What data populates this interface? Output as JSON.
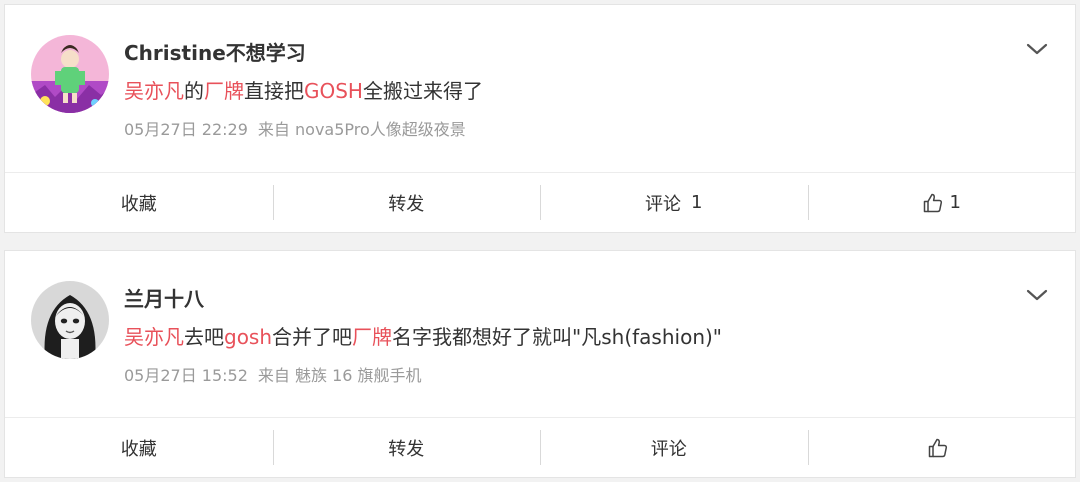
{
  "comments": [
    {
      "username": "Christine不想学习",
      "content": [
        {
          "text": "吴亦凡",
          "highlight": true
        },
        {
          "text": "的",
          "highlight": false
        },
        {
          "text": "厂牌",
          "highlight": true
        },
        {
          "text": "直接把",
          "highlight": false
        },
        {
          "text": "GOSH",
          "highlight": true
        },
        {
          "text": "全搬过来得了",
          "highlight": false
        }
      ],
      "time": "05月27日 22:29",
      "source": "来自 nova5Pro人像超级夜景",
      "actions": {
        "favorite": "收藏",
        "repost": "转发",
        "comment": "评论",
        "comment_count": "1",
        "like_count": "1"
      }
    },
    {
      "username": "兰月十八",
      "content": [
        {
          "text": "吴亦凡",
          "highlight": true
        },
        {
          "text": "去吧",
          "highlight": false
        },
        {
          "text": "gosh",
          "highlight": true
        },
        {
          "text": "合并了吧",
          "highlight": false
        },
        {
          "text": "厂牌",
          "highlight": true
        },
        {
          "text": "名字我都想好了就叫\"凡sh(fashion)\"",
          "highlight": false
        }
      ],
      "time": "05月27日 15:52",
      "source": "来自 魅族 16 旗舰手机",
      "actions": {
        "favorite": "收藏",
        "repost": "转发",
        "comment": "评论",
        "comment_count": "",
        "like_count": ""
      }
    }
  ],
  "icons": {
    "dropdown": "chevron-down-icon",
    "like": "thumbs-up-icon"
  },
  "colors": {
    "highlight": "#e8515a",
    "text": "#333333",
    "meta": "#9a9a9a",
    "background": "#f2f2f2"
  }
}
